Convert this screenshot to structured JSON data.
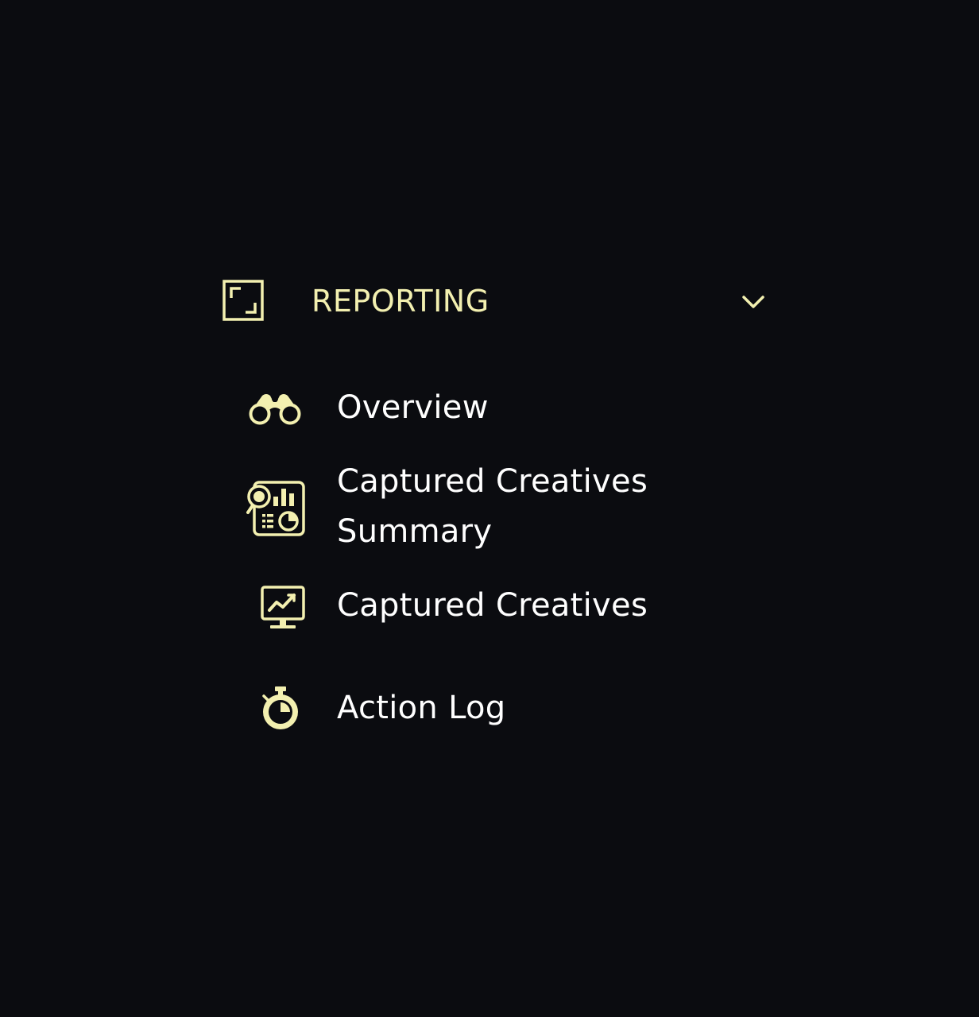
{
  "theme": {
    "background": "#0b0c10",
    "accent": "#f3f0b0",
    "text": "#ffffff"
  },
  "section": {
    "title": "REPORTING",
    "icon": "expand-frame-icon",
    "toggle_icon": "chevron-down-icon"
  },
  "items": [
    {
      "label": "Overview",
      "icon": "binoculars-icon"
    },
    {
      "label": "Captured Creatives Summary",
      "icon": "report-magnifier-icon"
    },
    {
      "label": "Captured Creatives",
      "icon": "monitor-chart-icon"
    },
    {
      "label": "Action Log",
      "icon": "stopwatch-icon"
    }
  ]
}
